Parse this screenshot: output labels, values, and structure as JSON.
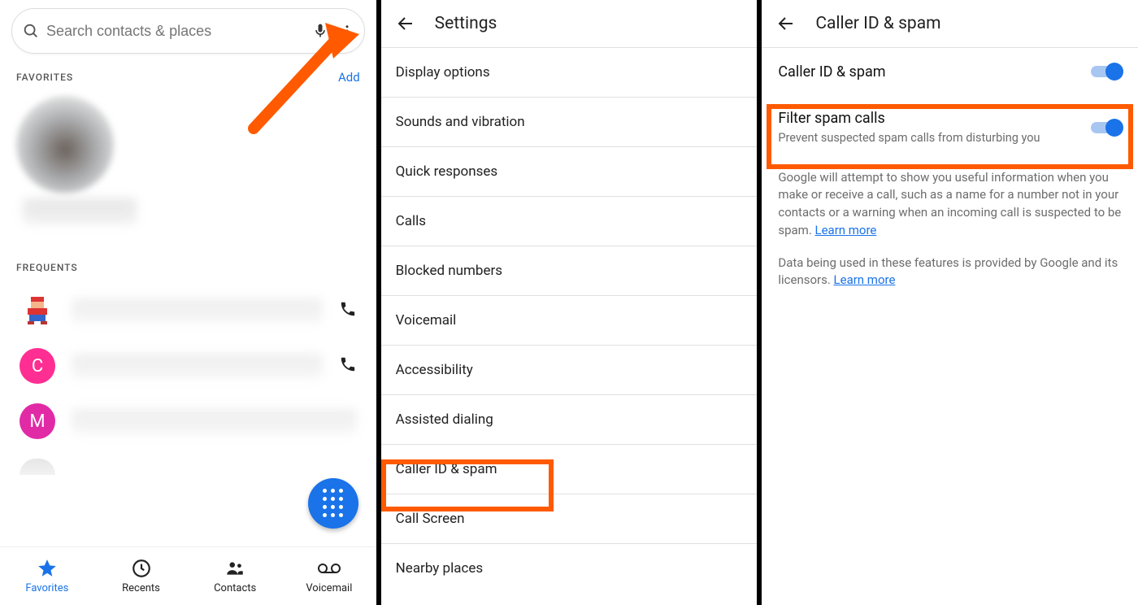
{
  "panel1": {
    "search_placeholder": "Search contacts & places",
    "favorites_label": "FAVORITES",
    "add_label": "Add",
    "frequents_label": "FREQUENTS",
    "freq_avatars": [
      "",
      "C",
      "M",
      ""
    ],
    "tabs": [
      "Favorites",
      "Recents",
      "Contacts",
      "Voicemail"
    ]
  },
  "panel2": {
    "title": "Settings",
    "items": [
      "Display options",
      "Sounds and vibration",
      "Quick responses",
      "Calls",
      "Blocked numbers",
      "Voicemail",
      "Accessibility",
      "Assisted dialing",
      "Caller ID & spam",
      "Call Screen",
      "Nearby places"
    ],
    "highlight_index": 8
  },
  "panel3": {
    "title": "Caller ID & spam",
    "row1_title": "Caller ID & spam",
    "row2_title": "Filter spam calls",
    "row2_sub": "Prevent suspected spam calls from disturbing you",
    "info1": "Google will attempt to show you useful information when you make or receive a call, such as a name for a number not in your contacts or a warning when an incoming call is suspected to be spam. ",
    "info2": "Data being used in these features is provided by Google and its licensors. ",
    "learn_more": "Learn more"
  },
  "annotations": {
    "arrow_color": "#ff5a00",
    "highlight_color": "#ff5a00"
  }
}
